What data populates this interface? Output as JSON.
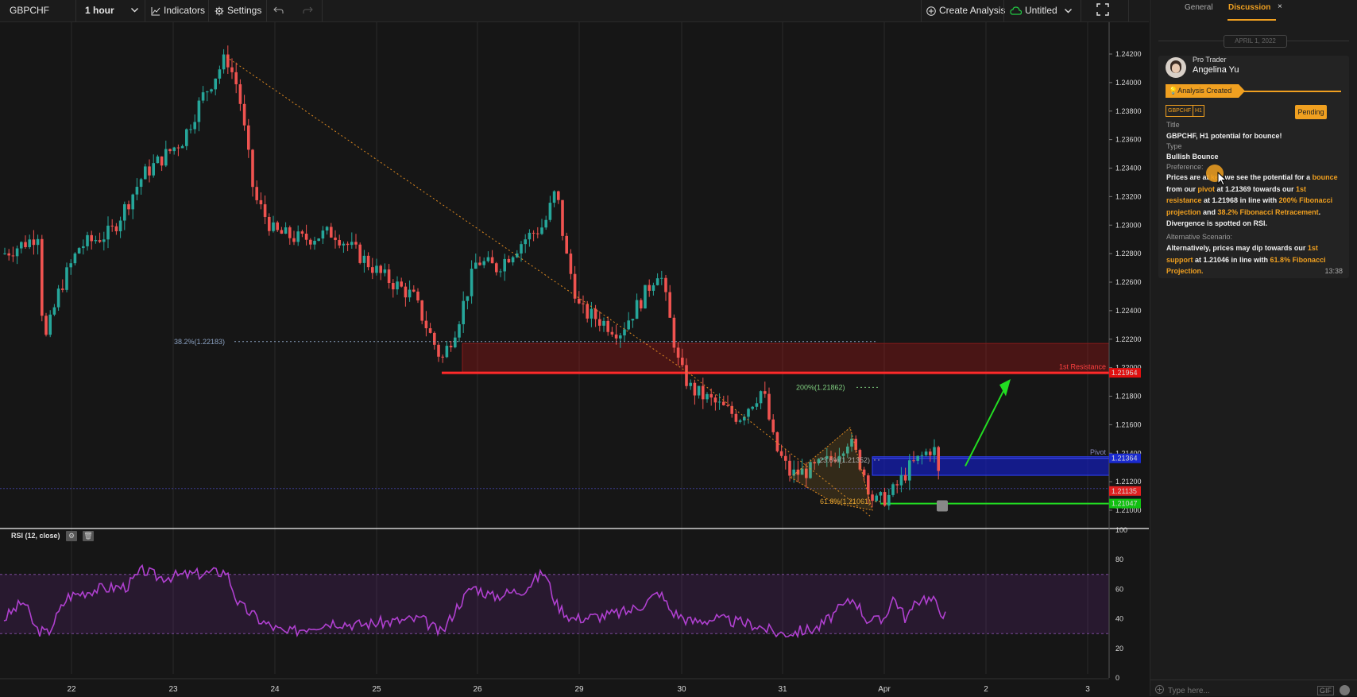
{
  "toolbar": {
    "symbol": "GBPCHF",
    "timeframe": "1 hour",
    "indicators_label": "Indicators",
    "settings_label": "Settings",
    "create_analysis_label": "Create Analysis",
    "workspace_label": "Untitled"
  },
  "chart": {
    "price_axis_labels": [
      "1.24200",
      "1.24000",
      "1.23800",
      "1.23600",
      "1.23400",
      "1.23200",
      "1.23000",
      "1.22800",
      "1.22600",
      "1.22400",
      "1.22200",
      "1.22000",
      "1.21800",
      "1.21600",
      "1.21400",
      "1.21200",
      "1.21000"
    ],
    "date_labels": [
      "22",
      "23",
      "24",
      "25",
      "26",
      "29",
      "30",
      "31",
      "Apr",
      "2",
      "3"
    ],
    "annotations": {
      "fib_382": "38.2%(1.22183)",
      "fib_200": "200%(1.21862)",
      "fib_236": "23.6%(1.21352)",
      "fib_618": "61.8%(1.21061)",
      "resistance_label": "1st Resistance",
      "pivot_label": "Pivot"
    },
    "price_tags": {
      "resistance": "1.21964",
      "pivot": "1.21364",
      "current": "1.21135",
      "support": "1.21047"
    },
    "colors": {
      "up_candle": "#26a69a",
      "down_candle": "#ef5350",
      "resistance": "#ff2a2a",
      "pivot": "#1f2fd8",
      "support": "#22dd22",
      "rsi_line": "#b040d0",
      "fib": "#e0a030"
    }
  },
  "rsi": {
    "label": "RSI (12, close)",
    "axis_labels": [
      "100",
      "80",
      "60",
      "40",
      "20",
      "0"
    ]
  },
  "side_panel": {
    "tab_general": "General",
    "tab_discussion": "Discussion",
    "close_glyph": "×",
    "date_divider": "APRIL 1, 2022",
    "author_role": "Pro Trader",
    "author_name": "Angelina Yu",
    "event_label": "Analysis Created",
    "tag_symbol": "GBPCHF",
    "tag_timeframe": "H1",
    "status": "Pending",
    "title_heading": "Title",
    "title_value": "GBPCHF, H1 potential for bounce!",
    "type_heading": "Type",
    "type_value": "Bullish Bounce",
    "preference_heading": "Preference:",
    "alt_heading": "Alternative Scenario:",
    "time": "13:38",
    "input_placeholder": "Type here...",
    "gif_label": "GIF"
  }
}
